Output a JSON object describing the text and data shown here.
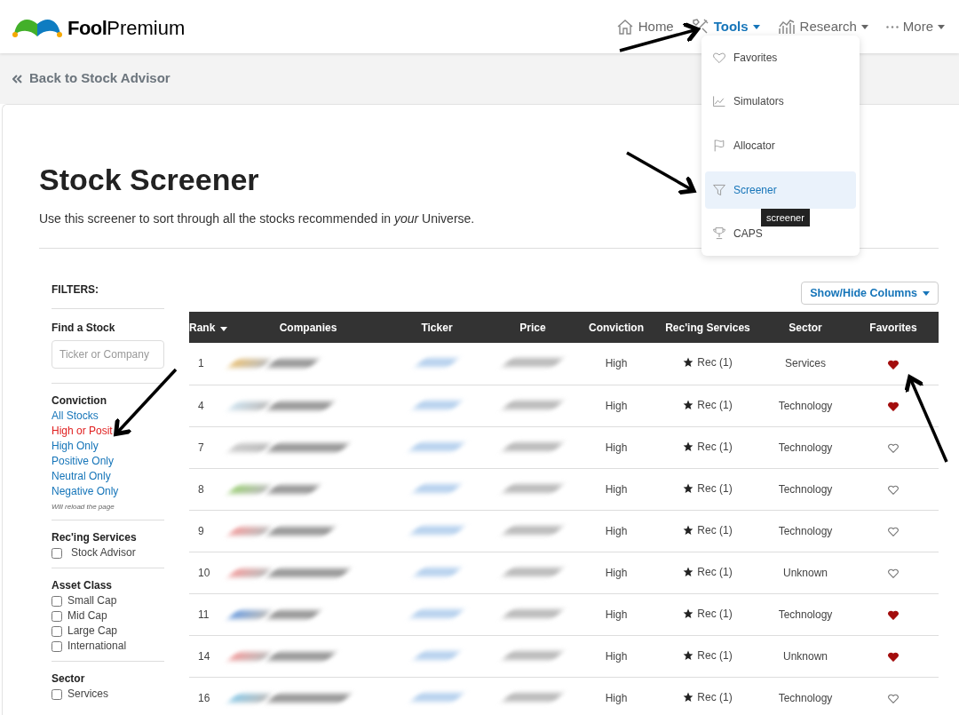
{
  "header": {
    "logo": {
      "brand": "Fool",
      "product": "Premium"
    },
    "nav": [
      {
        "label": "Home",
        "kind": "home",
        "selected": false,
        "dropdown": false
      },
      {
        "label": "Tools",
        "kind": "tools",
        "selected": true,
        "dropdown": true
      },
      {
        "label": "Research",
        "kind": "chart",
        "selected": false,
        "dropdown": true
      },
      {
        "label": "More",
        "kind": "dots",
        "selected": false,
        "dropdown": true
      }
    ]
  },
  "tools_menu": {
    "items": [
      {
        "label": "Favorites",
        "kind": "heart",
        "selected": false
      },
      {
        "label": "Simulators",
        "kind": "trend",
        "selected": false
      },
      {
        "label": "Allocator",
        "kind": "flag",
        "selected": false
      },
      {
        "label": "Screener",
        "kind": "filter",
        "selected": true
      },
      {
        "label": "CAPS",
        "kind": "trophy",
        "selected": false
      }
    ],
    "tooltip": "screener"
  },
  "back_link": "Back to Stock Advisor",
  "page": {
    "title": "Stock Screener",
    "subtitle": "Use this screener to sort through all the stocks recommended in *your* Universe."
  },
  "filters": {
    "heading": "FILTERS:",
    "find": {
      "label": "Find a Stock",
      "placeholder": "Ticker or Company"
    },
    "conviction": {
      "label": "Conviction",
      "options": [
        {
          "label": "All Stocks",
          "selected": false
        },
        {
          "label": "High or Posit",
          "selected": true
        },
        {
          "label": "High Only",
          "selected": false
        },
        {
          "label": "Positive Only",
          "selected": false
        },
        {
          "label": "Neutral Only",
          "selected": false
        },
        {
          "label": "Negative Only",
          "selected": false
        }
      ],
      "note": "Will reload the page"
    },
    "groups": [
      {
        "label": "Rec'ing Services",
        "options": [
          {
            "label": "Stock Advisor",
            "checked": false
          }
        ]
      },
      {
        "label": "Asset Class",
        "options": [
          {
            "label": "Small Cap",
            "checked": false
          },
          {
            "label": "Mid Cap",
            "checked": false
          },
          {
            "label": "Large Cap",
            "checked": false
          },
          {
            "label": "International",
            "checked": false
          }
        ]
      },
      {
        "label": "Sector",
        "options": [
          {
            "label": "Services",
            "checked": false
          }
        ]
      }
    ]
  },
  "table": {
    "columns_button": "Show/Hide Columns",
    "columns": [
      {
        "label": "Rank",
        "sorted": true
      },
      {
        "label": "Companies",
        "sorted": false
      },
      {
        "label": "Ticker",
        "sorted": false
      },
      {
        "label": "Price",
        "sorted": false
      },
      {
        "label": "Conviction",
        "sorted": false
      },
      {
        "label": "Rec'ing Services",
        "sorted": false
      },
      {
        "label": "Sector",
        "sorted": false
      },
      {
        "label": "Favorites",
        "sorted": false
      }
    ],
    "rows": [
      {
        "rank": "1",
        "conviction": "High",
        "rec": "Rec (1)",
        "sector": "Services",
        "favorite": true
      },
      {
        "rank": "4",
        "conviction": "High",
        "rec": "Rec (1)",
        "sector": "Technology",
        "favorite": true
      },
      {
        "rank": "7",
        "conviction": "High",
        "rec": "Rec (1)",
        "sector": "Technology",
        "favorite": false
      },
      {
        "rank": "8",
        "conviction": "High",
        "rec": "Rec (1)",
        "sector": "Technology",
        "favorite": false
      },
      {
        "rank": "9",
        "conviction": "High",
        "rec": "Rec (1)",
        "sector": "Technology",
        "favorite": false
      },
      {
        "rank": "10",
        "conviction": "High",
        "rec": "Rec (1)",
        "sector": "Unknown",
        "favorite": false
      },
      {
        "rank": "11",
        "conviction": "High",
        "rec": "Rec (1)",
        "sector": "Technology",
        "favorite": true
      },
      {
        "rank": "14",
        "conviction": "High",
        "rec": "Rec (1)",
        "sector": "Unknown",
        "favorite": true
      },
      {
        "rank": "16",
        "conviction": "High",
        "rec": "Rec (1)",
        "sector": "Technology",
        "favorite": false
      }
    ]
  }
}
